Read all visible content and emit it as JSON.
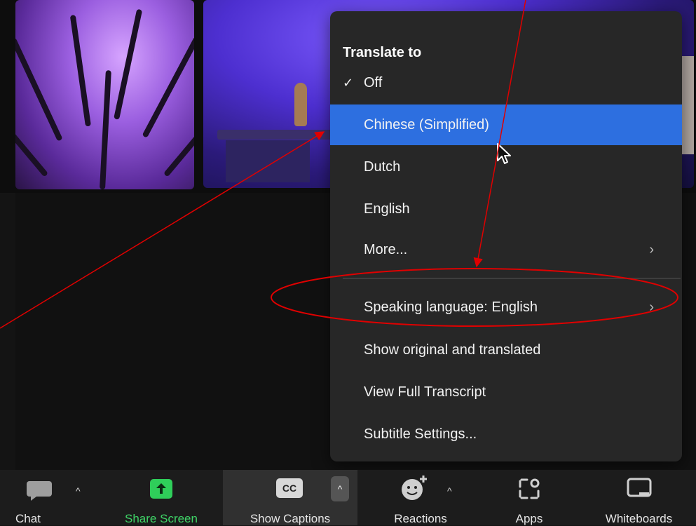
{
  "menu": {
    "header": "Translate to",
    "check_mark": "✓",
    "items": [
      {
        "label": "Off"
      },
      {
        "label": "Chinese (Simplified)"
      },
      {
        "label": "Dutch"
      },
      {
        "label": "English"
      },
      {
        "label": "More...",
        "chevron": "›"
      },
      {
        "label": "Speaking language: English",
        "chevron": "›"
      },
      {
        "label": "Show original and translated"
      },
      {
        "label": "View Full Transcript"
      },
      {
        "label": "Subtitle Settings..."
      }
    ]
  },
  "toolbar": {
    "caret_glyph": "^",
    "buttons": [
      {
        "label": "Chat"
      },
      {
        "label": "Share Screen"
      },
      {
        "label": "Show Captions",
        "icon_text": "CC"
      },
      {
        "label": "Reactions"
      },
      {
        "label": "Apps"
      },
      {
        "label": "Whiteboards"
      }
    ]
  },
  "colors": {
    "menu_bg": "#272727",
    "selected_item": "#2d6fe0",
    "share_screen_green": "#3fd467",
    "annotation_red": "#e00000"
  },
  "icons": {
    "chat": "speech-bubble-icon",
    "share": "share-up-arrow-icon",
    "captions": "cc-icon",
    "reactions": "smiley-plus-icon",
    "apps": "apps-icon",
    "whiteboards": "whiteboard-icon"
  }
}
